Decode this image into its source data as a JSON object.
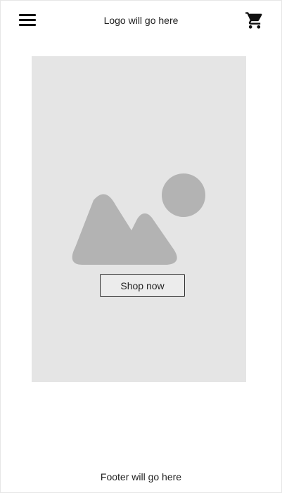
{
  "header": {
    "menu_icon": "hamburger-menu-icon",
    "logo_text": "Logo will go here",
    "cart_icon": "shopping-cart-icon"
  },
  "hero": {
    "image_icon": "image-placeholder-icon",
    "shop_button_label": "Shop now"
  },
  "footer": {
    "text": "Footer will go here"
  },
  "colors": {
    "hero_background": "#e5e5e5",
    "placeholder_shape": "#b3b3b3",
    "button_background": "#ececec",
    "icon_dark": "#111111"
  }
}
